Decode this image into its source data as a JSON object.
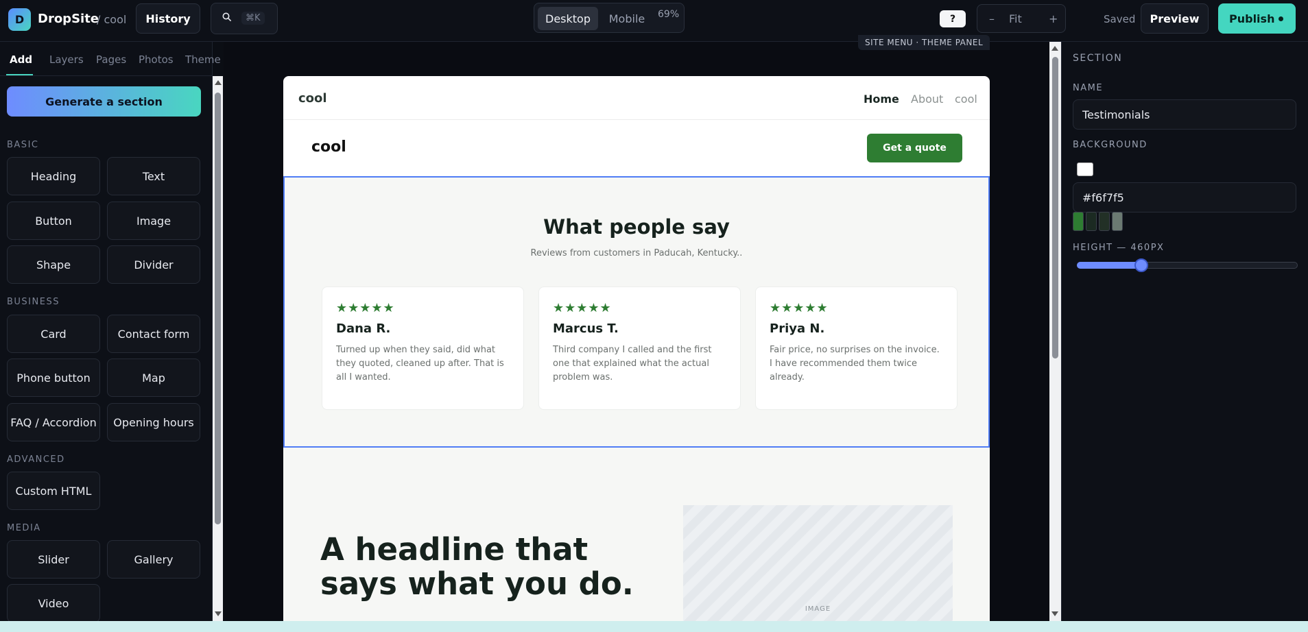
{
  "app": {
    "logo_letter": "D",
    "brand": "DropSite",
    "breadcrumb": "/ cool",
    "history_label": "History",
    "search_shortcut": "⌘K",
    "view_modes": [
      "Desktop",
      "Mobile"
    ],
    "active_view": "Desktop",
    "zoom": "69%",
    "help_label": "?",
    "zoom_controls": {
      "minus": "–",
      "fit": "Fit",
      "plus": "+"
    },
    "save_status": "Saved",
    "preview_label": "Preview",
    "publish_label": "Publish"
  },
  "left_panel": {
    "tabs": [
      "Add",
      "Layers",
      "Pages",
      "Photos",
      "Theme"
    ],
    "active_tab": "Add",
    "generate_label": "Generate a section",
    "groups": {
      "basic": {
        "label": "BASIC",
        "items": [
          "Heading",
          "Text",
          "Button",
          "Image",
          "Shape",
          "Divider"
        ]
      },
      "business": {
        "label": "BUSINESS",
        "items": [
          "Card",
          "Contact form",
          "Phone button",
          "Map",
          "FAQ / Accordion",
          "Opening hours"
        ]
      },
      "advanced": {
        "label": "ADVANCED",
        "items": [
          "Custom HTML"
        ]
      },
      "media": {
        "label": "MEDIA",
        "items": [
          "Slider",
          "Gallery",
          "Video"
        ]
      }
    }
  },
  "canvas": {
    "overlay_tag": "SITE MENU · THEME PANEL",
    "site": {
      "nav_brand": "cool",
      "nav_links": [
        "Home",
        "About",
        "cool"
      ],
      "active_link": "Home",
      "header_brand": "cool",
      "cta_label": "Get a quote",
      "testimonials": {
        "title": "What people say",
        "subtitle": "Reviews from customers in Paducah, Kentucky..",
        "cards": [
          {
            "stars": "★★★★★",
            "name": "Dana R.",
            "text": "Turned up when they said, did what they quoted, cleaned up after. That is all I wanted."
          },
          {
            "stars": "★★★★★",
            "name": "Marcus T.",
            "text": "Third company I called and the first one that explained what the actual problem was."
          },
          {
            "stars": "★★★★★",
            "name": "Priya N.",
            "text": "Fair price, no surprises on the invoice. I have recommended them twice already."
          }
        ]
      },
      "hero": {
        "headline": "A headline that says what you do.",
        "image_label": "IMAGE"
      }
    }
  },
  "right_panel": {
    "section_heading": "SECTION",
    "name_label": "NAME",
    "name_value": "Testimonials",
    "background_label": "BACKGROUND",
    "background_value": "#f6f7f5",
    "swatches": [
      "#2e7d32",
      "#1b2a22",
      "#223026",
      "#6b7a72"
    ],
    "height_label": "HEIGHT — 460PX",
    "height_fraction": 0.24
  },
  "colors": {
    "accent": "#49d6c0",
    "primary_blue": "#6e8cff",
    "site_green": "#2e7d32",
    "selection_outline": "#4f7cf5"
  }
}
